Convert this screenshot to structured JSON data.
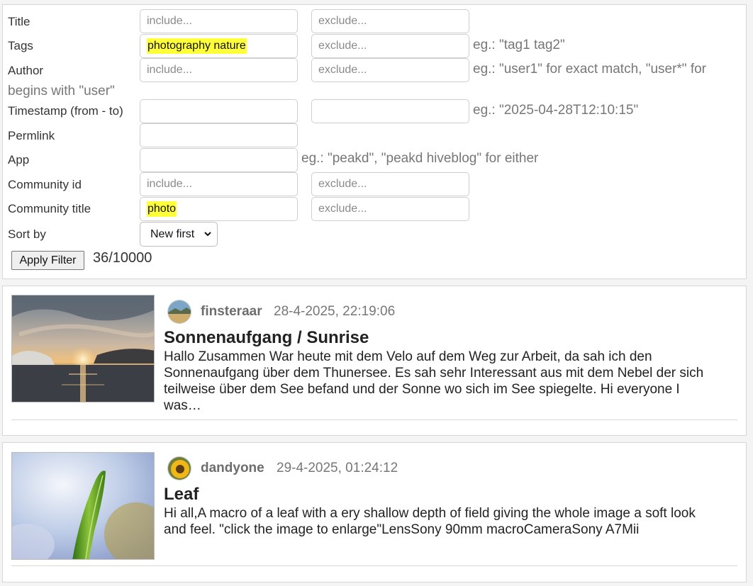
{
  "filter": {
    "rows": [
      {
        "label": "Title",
        "include_placeholder": "include...",
        "exclude_placeholder": "exclude...",
        "include_value": ""
      },
      {
        "label": "Tags",
        "include_value": "photography nature",
        "exclude_placeholder": "exclude...",
        "hint": "eg.: \"tag1 tag2\""
      },
      {
        "label": "Author",
        "include_placeholder": "include...",
        "exclude_placeholder": "exclude...",
        "hint_line1": "eg.: \"user1\" for exact match, \"user*\" for",
        "hint_line2": "begins with \"user\""
      },
      {
        "label": "Timestamp (from - to)",
        "hint": "eg.: \"2025-04-28T12:10:15\""
      },
      {
        "label": "Permlink"
      },
      {
        "label": "App",
        "hint": "eg.: \"peakd\", \"peakd hiveblog\" for either"
      },
      {
        "label": "Community id",
        "include_placeholder": "include...",
        "exclude_placeholder": "exclude..."
      },
      {
        "label": "Community title",
        "include_value": "photo",
        "exclude_placeholder": "exclude..."
      },
      {
        "label": "Sort by",
        "sort_value": "New first"
      }
    ],
    "apply_label": "Apply Filter",
    "result_count": "36/10000"
  },
  "posts": [
    {
      "author": "finsteraar",
      "date": "28-4-2025, 22:19:06",
      "title": "Sonnenaufgang / Sunrise",
      "body_lines": [
        "Hallo Zusammen War heute mit dem Velo auf dem Weg zur Arbeit, da sah ich den",
        "Sonnenaufgang über dem Thunersee. Es sah sehr Interessant aus mit dem Nebel der sich",
        "teilweise über dem See befand und der Sonne wo sich im See spiegelte. Hi everyone I",
        "was…"
      ],
      "image_icon": "sunrise-lake-photo",
      "avatar_icon": "landscape-avatar"
    },
    {
      "author": "dandyone",
      "date": "29-4-2025, 01:24:12",
      "title": "Leaf",
      "body_lines": [
        "Hi all,A macro of a leaf with a ery shallow depth of field giving the whole image a soft look",
        "and feel. \"click the image to enlarge\"LensSony 90mm macroCameraSony A7Mii"
      ],
      "image_icon": "leaf-macro-photo",
      "avatar_icon": "sunflower-avatar"
    }
  ],
  "colors": {
    "highlight": "#ffff3a",
    "muted": "#777777"
  }
}
